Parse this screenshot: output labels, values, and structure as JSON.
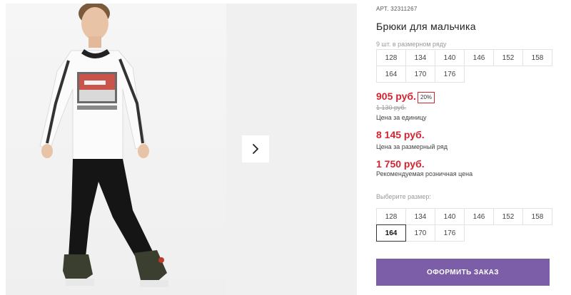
{
  "product": {
    "sku_label": "АРТ.",
    "sku_value": "32311267",
    "title": "Брюки для мальчика",
    "pack_note": "9 шт. в размерном ряду"
  },
  "size_row": [
    "128",
    "134",
    "140",
    "146",
    "152",
    "158",
    "164",
    "170",
    "176"
  ],
  "prices": {
    "unit_price": "905 руб.",
    "discount_badge": "20%",
    "old_price": "1 130 руб.",
    "unit_caption": "Цена за единицу",
    "row_price": "8 145 руб.",
    "row_caption": "Цена за размерный ряд",
    "rrp_price": "1 750 руб.",
    "rrp_caption": "Рекомендуемая розничная цена"
  },
  "size_picker": {
    "label": "Выберите размер:",
    "options": [
      "128",
      "134",
      "140",
      "146",
      "152",
      "158",
      "164",
      "170",
      "176"
    ],
    "selected": "164"
  },
  "actions": {
    "order_label": "ОФОРМИТЬ ЗАКАЗ"
  },
  "colors": {
    "price_red": "#d6232f",
    "button_purple": "#7b5ea7"
  },
  "icons": {
    "next": "chevron-right-icon"
  }
}
